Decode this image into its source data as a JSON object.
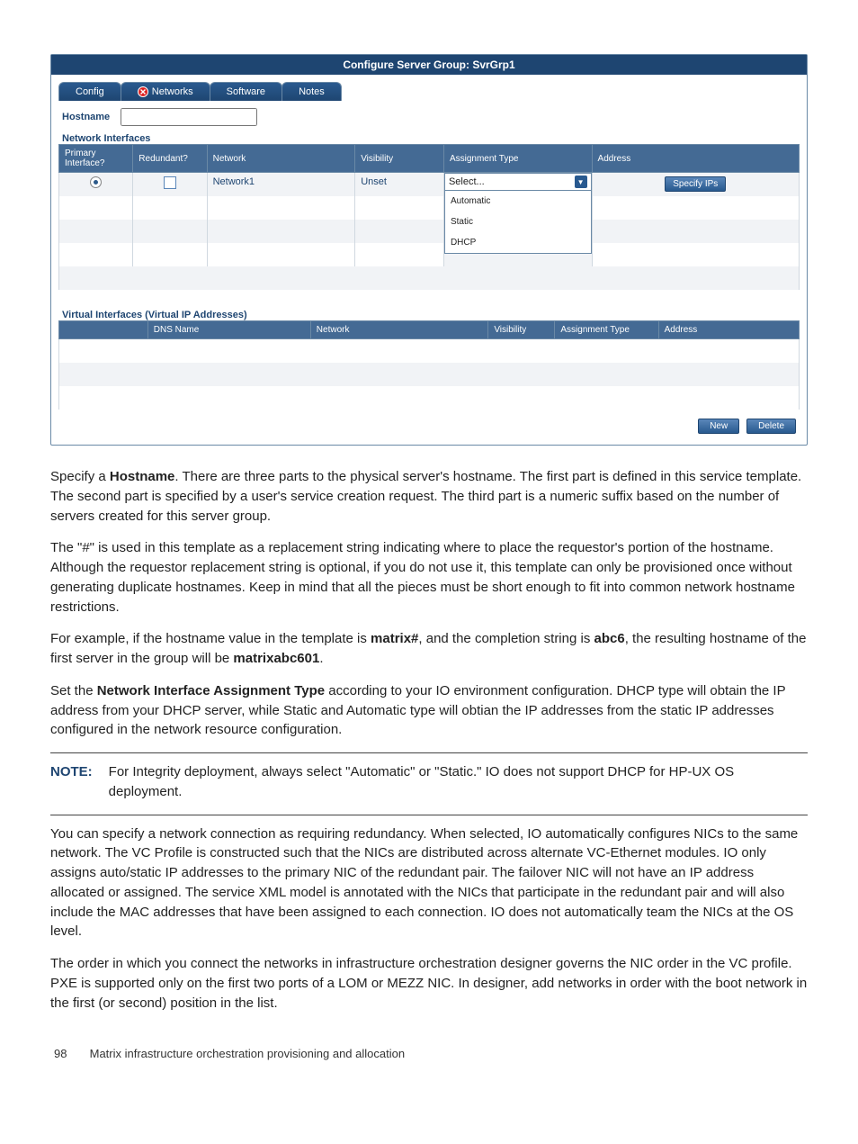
{
  "panel": {
    "title": "Configure Server Group: SvrGrp1",
    "tabs": {
      "config": "Config",
      "networks": "Networks",
      "software": "Software",
      "notes": "Notes"
    },
    "hostname_label": "Hostname",
    "hostname_value": "",
    "net_interfaces_label": "Network Interfaces",
    "net_cols": {
      "primary": "Primary Interface?",
      "redundant": "Redundant?",
      "network": "Network",
      "visibility": "Visibility",
      "assignment": "Assignment Type",
      "address": "Address"
    },
    "net_row1": {
      "network": "Network1",
      "visibility": "Unset",
      "assignment_selected": "Select...",
      "specify_btn": "Specify IPs"
    },
    "assign_options": {
      "automatic": "Automatic",
      "static": "Static",
      "dhcp": "DHCP"
    },
    "virt_label": "Virtual Interfaces (Virtual IP Addresses)",
    "virt_cols": {
      "blank": "",
      "dnsname": "DNS Name",
      "network": "Network",
      "visibility": "Visibility",
      "assignment": "Assignment Type",
      "address": "Address"
    },
    "buttons": {
      "new": "New",
      "delete": "Delete"
    }
  },
  "text": {
    "p1a": "Specify a ",
    "p1b": "Hostname",
    "p1c": ". There are three parts to the physical server's hostname. The first part is defined in this service template. The second part is specified by a user's service creation request. The third part is a numeric suffix based on the number of servers created for this server group.",
    "p2": "The \"#\" is used in this template as a replacement string indicating where to place the requestor's portion of the hostname. Although the requestor replacement string is optional, if you do not use it, this template can only be provisioned once without generating duplicate hostnames. Keep in mind that all the pieces must be short enough to fit into common network hostname restrictions.",
    "p3a": "For example, if the hostname value in the template is ",
    "p3b": "matrix#",
    "p3c": ", and the completion string is ",
    "p3d": "abc6",
    "p3e": ", the resulting hostname of the first server in the group will be ",
    "p3f": "matrixabc601",
    "p3g": ".",
    "p4a": "Set the ",
    "p4b": "Network Interface Assignment Type",
    "p4c": " according to your IO environment configuration. DHCP type will obtain the IP address from your DHCP server, while Static and Automatic type will obtian the IP addresses from the static IP addresses configured in the network resource configuration.",
    "note_label": "NOTE:",
    "note_body": "For Integrity deployment, always select \"Automatic\" or \"Static.\" IO does not support DHCP for HP-UX OS deployment.",
    "p5": "You can specify a network connection as requiring redundancy. When selected, IO automatically configures NICs to the same network. The VC Profile is constructed such that the NICs are distributed across alternate VC-Ethernet modules. IO only assigns auto/static IP addresses to the primary NIC of the redundant pair. The failover NIC will not have an IP address allocated or assigned. The service XML model is annotated with the NICs that participate in the redundant pair and will also include the MAC addresses that have been assigned to each connection. IO does not automatically team the NICs at the OS level.",
    "p6": "The order in which you connect the networks in infrastructure orchestration designer governs the NIC order in the VC profile. PXE is supported only on the first two ports of a LOM or MEZZ NIC. In designer, add networks in order with the boot network in the first (or second) position in the list."
  },
  "footer": {
    "page": "98",
    "chapter": "Matrix infrastructure orchestration provisioning and allocation"
  }
}
